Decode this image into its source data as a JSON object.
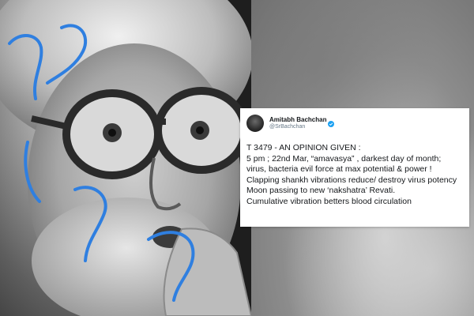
{
  "tweet": {
    "display_name": "Amitabh Bachchan",
    "handle": "@SrBachchan",
    "verified_icon": "verified-badge-icon",
    "lines": [
      "T 3479 - AN OPINION GIVEN :",
      "5 pm ; 22nd Mar, “amavasya” , darkest day of month;",
      "virus, bacteria evil force at max potential & power !",
      "Clapping shankh vibrations reduce/ destroy virus potency",
      "Moon passing to new ‘nakshatra’ Revati.",
      "Cumulative vibration betters blood circulation"
    ]
  },
  "colors": {
    "verified_blue": "#1da1f2",
    "annotation_blue": "#2f7fe0"
  }
}
